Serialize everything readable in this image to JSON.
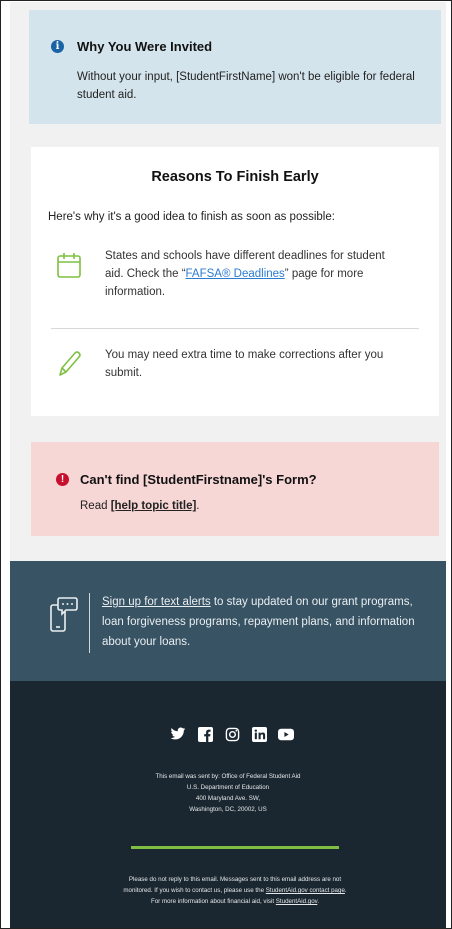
{
  "invited": {
    "title": "Why You Were Invited",
    "body": "Without your input, [StudentFirstName] won't be eligible for federal student aid."
  },
  "reasons": {
    "title": "Reasons To Finish Early",
    "intro": "Here's why it's a good idea to finish as soon as possible:",
    "item1_pre": "States and schools have different deadlines for student aid. Check the “",
    "item1_link": "FAFSA® Deadlines",
    "item1_post": "” page for more information.",
    "item2": "You may need extra time to make corrections after you submit."
  },
  "alert": {
    "title": "Can't find [StudentFirstname]'s Form?",
    "read_pre": "Read ",
    "read_link": "[help topic title]",
    "read_post": "."
  },
  "sms": {
    "link": "Sign up for text alerts",
    "rest": " to stay updated on our grant programs, loan forgiveness programs, repayment plans, and information about your loans."
  },
  "footer": {
    "sent_lines": [
      "This email was sent by: Office of Federal Student Aid",
      "U.S. Department of Education",
      "400 Maryland Ave. SW,",
      "Washington, DC, 20002, US"
    ],
    "noreply_pre": "Please do not reply to this email. Messages sent to this email address are not monitored. If you wish to contact us, please use the ",
    "noreply_link1": "StudentAid.gov contact page",
    "noreply_mid": ". For more information about financial aid, visit ",
    "noreply_link2": "StudentAid.gov",
    "noreply_end": ".",
    "social_icons": [
      "twitter-icon",
      "facebook-icon",
      "instagram-icon",
      "linkedin-icon",
      "youtube-icon"
    ]
  },
  "colors": {
    "info": "#1a63a5",
    "alert": "#c8102e",
    "accent_green": "#7fc042",
    "band": "#385364",
    "footer": "#1b2730"
  }
}
